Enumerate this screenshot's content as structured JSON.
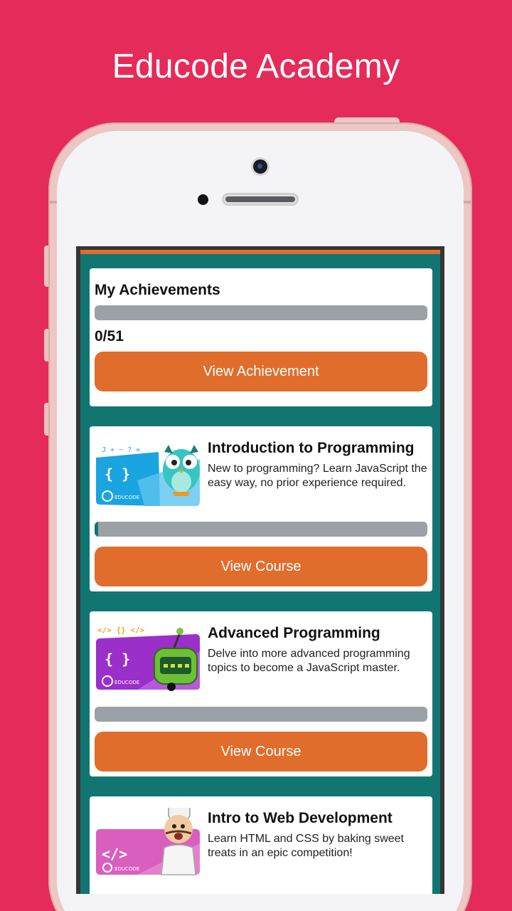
{
  "headline": "Educode Academy",
  "achievements": {
    "title": "My Achievements",
    "progress": 0,
    "count_text": "0/51",
    "button_label": "View Achievement"
  },
  "courses": [
    {
      "title": "Introduction to Programming",
      "description": "New to programming? Learn JavaScript the easy way, no prior experience required.",
      "progress": 0.01,
      "button_label": "View Course",
      "thumb_icon": "{ }",
      "thumb_brand": "EDUCODE",
      "thumb_color": "#1aa4e0",
      "mascot": "owl-icon"
    },
    {
      "title": "Advanced Programming",
      "description": "Delve into more advanced programming topics to become a JavaScript master.",
      "progress": 0,
      "button_label": "View Course",
      "thumb_icon": "{ }",
      "thumb_brand": "EDUCODE",
      "thumb_color": "#9b2fc9",
      "mascot": "robot-icon"
    },
    {
      "title": "Intro to Web Development",
      "description": "Learn HTML and CSS by baking sweet treats in an epic competition!",
      "thumb_icon": "</>",
      "thumb_brand": "EDUCODE",
      "thumb_color": "#d95fbf",
      "mascot": "chef-icon"
    }
  ],
  "colors": {
    "background": "#e52b5a",
    "screen_bg": "#117672",
    "accent": "#e06d2c",
    "bar_track": "#9ca1a8"
  }
}
